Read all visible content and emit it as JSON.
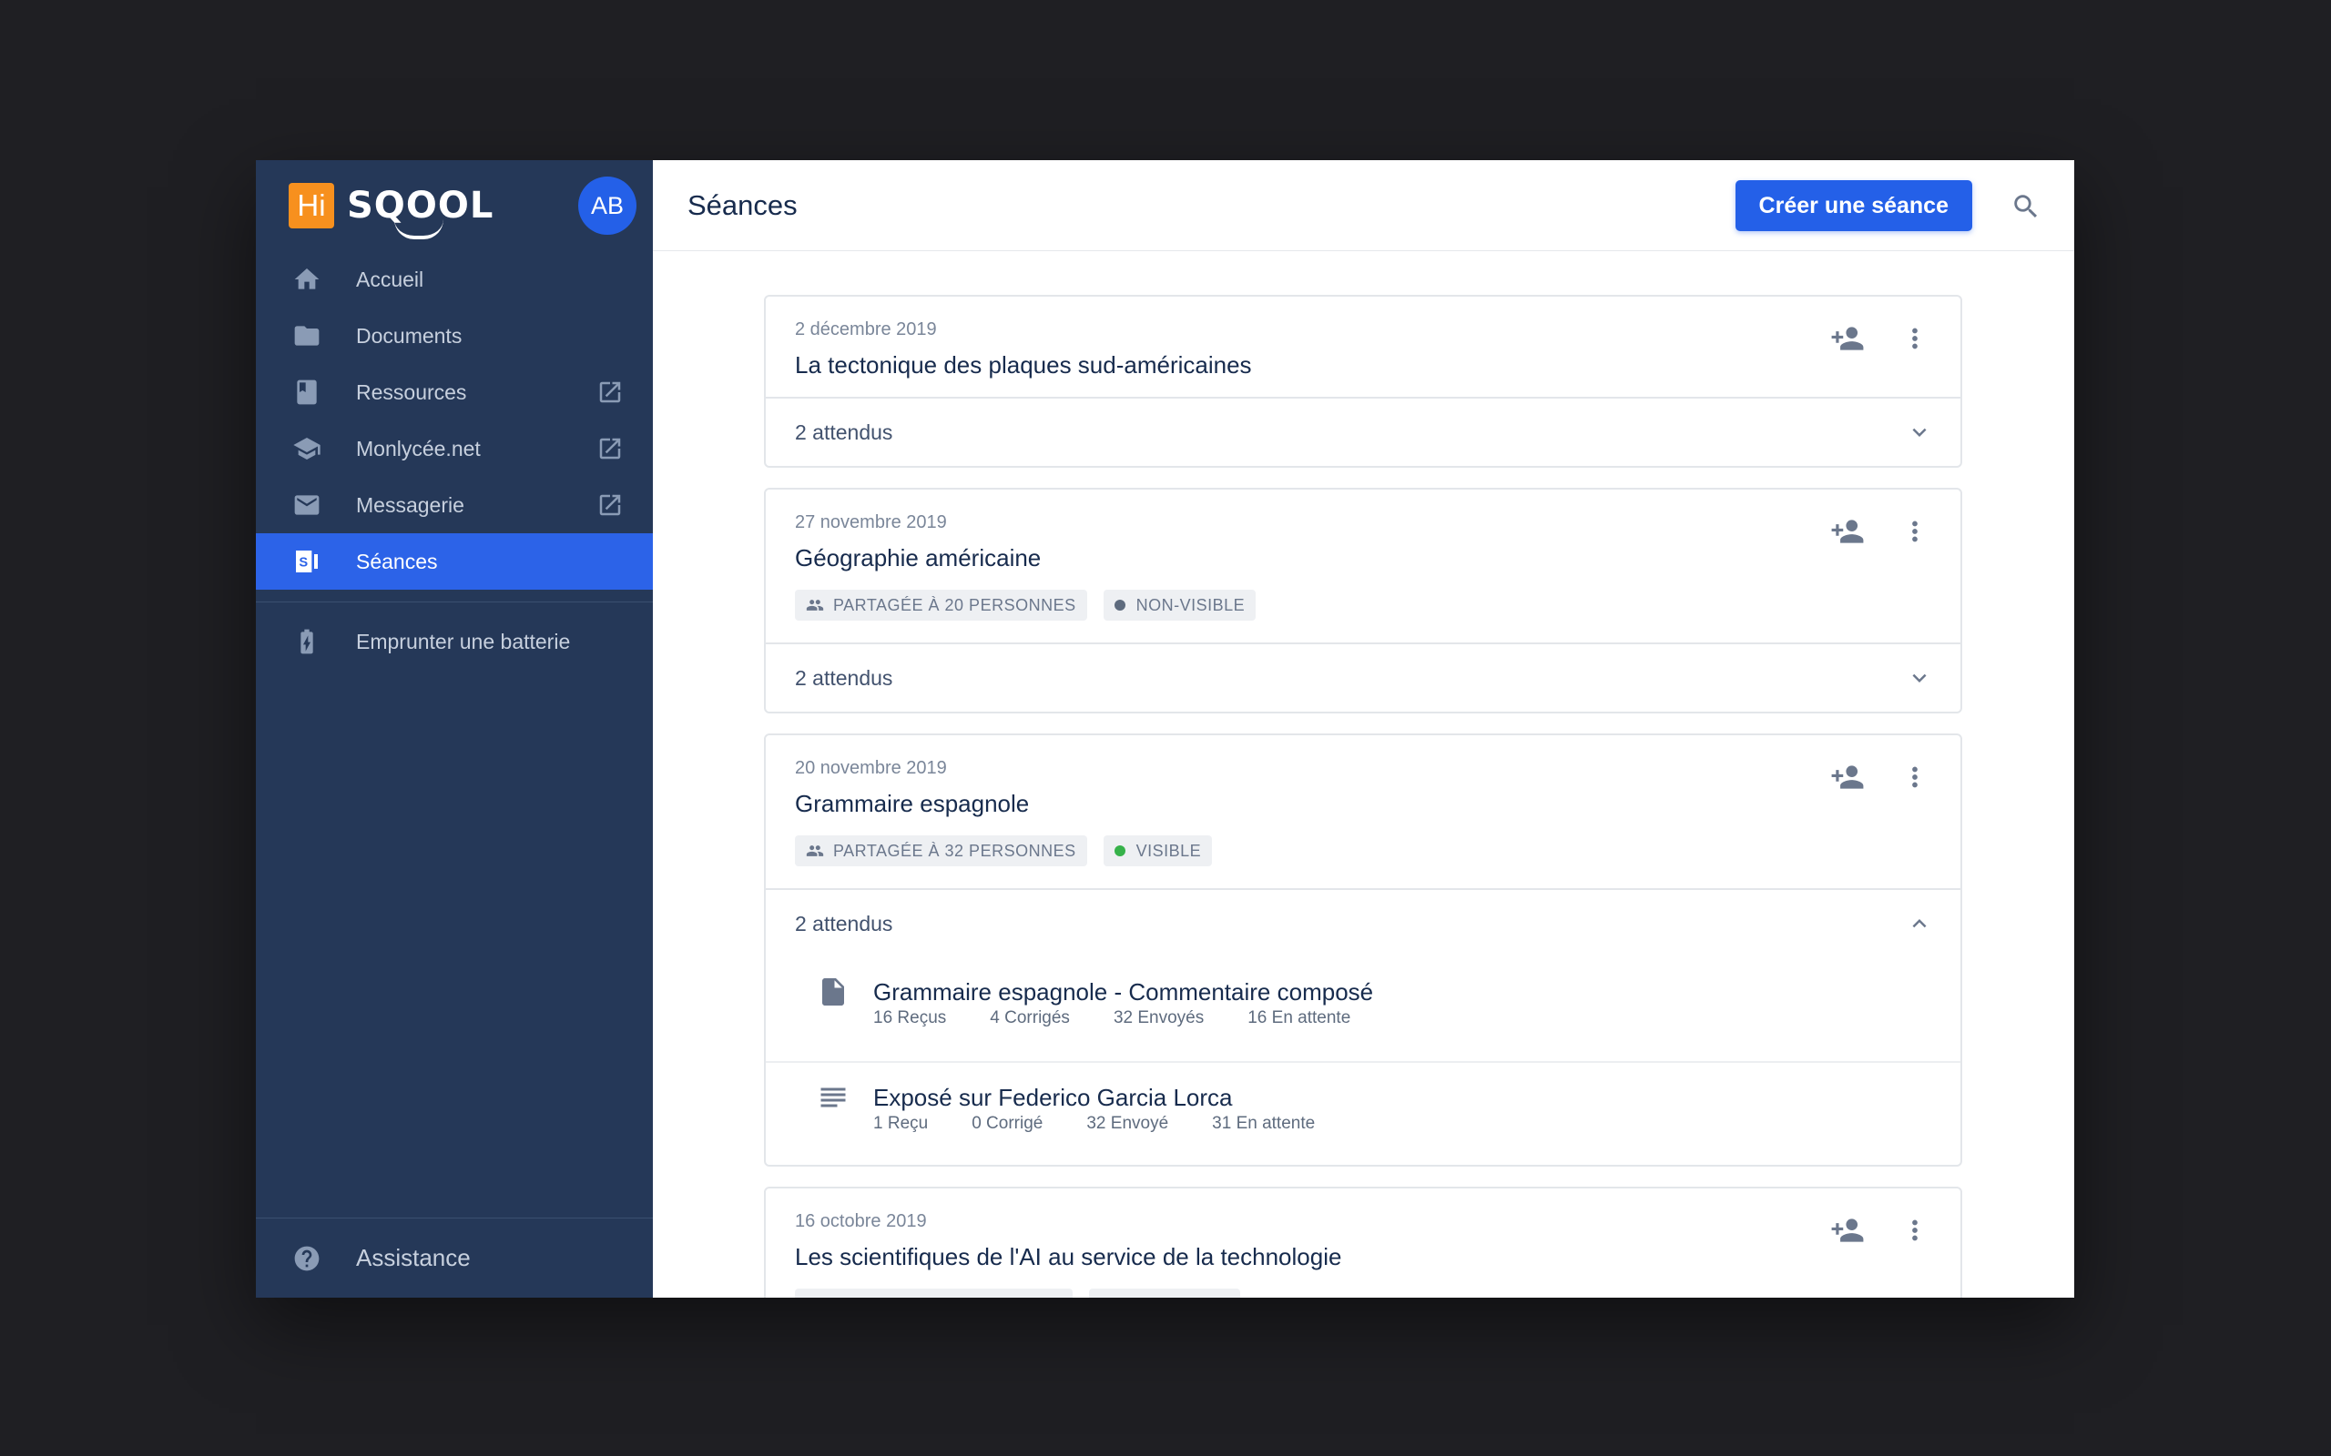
{
  "sidebar": {
    "logo_badge": "Hi",
    "logo_text": "SQOOL",
    "avatar": "AB",
    "items": [
      {
        "label": "Accueil",
        "icon": "home-icon",
        "external": false,
        "active": false
      },
      {
        "label": "Documents",
        "icon": "folder-icon",
        "external": false,
        "active": false
      },
      {
        "label": "Ressources",
        "icon": "book-icon",
        "external": true,
        "active": false
      },
      {
        "label": "Monlycée.net",
        "icon": "school-icon",
        "external": true,
        "active": false
      },
      {
        "label": "Messagerie",
        "icon": "mail-icon",
        "external": true,
        "active": false
      },
      {
        "label": "Séances",
        "icon": "sessions-icon",
        "external": false,
        "active": true
      }
    ],
    "secondary": {
      "label": "Emprunter une batterie",
      "icon": "battery-icon"
    },
    "assist_label": "Assistance"
  },
  "header": {
    "title": "Séances",
    "create_label": "Créer une séance"
  },
  "cards": [
    {
      "date": "2 décembre 2019",
      "title": "La tectonique des plaques sud-américaines",
      "attendus": "2 attendus",
      "expanded": false
    },
    {
      "date": "27 novembre 2019",
      "title": "Géographie américaine",
      "share_tag": "PARTAGÉE À 20 PERSONNES",
      "visibility_tag": "NON-VISIBLE",
      "attendus": "2 attendus",
      "expanded": false
    },
    {
      "date": "20 novembre 2019",
      "title": "Grammaire espagnole",
      "share_tag": "PARTAGÉE À 32 PERSONNES",
      "visibility_tag": "VISIBLE",
      "attendus": "2 attendus",
      "expanded": true,
      "items": [
        {
          "title": "Grammaire espagnole - Commentaire composé",
          "icon": "document-icon",
          "stats": [
            "16 Reçus",
            "4 Corrigés",
            "32 Envoyés",
            "16 En attente"
          ]
        },
        {
          "title": "Exposé sur Federico Garcia Lorca",
          "icon": "text-lines-icon",
          "stats": [
            "1 Reçu",
            "0 Corrigé",
            "32 Envoyé",
            "31 En attente"
          ]
        }
      ]
    },
    {
      "date": "16 octobre 2019",
      "title": "Les scientifiques de l'AI au service de la technologie"
    }
  ],
  "colors": {
    "accent": "#2460e8",
    "sidebar_bg": "#253858",
    "logo_orange": "#f7901e",
    "visible_green": "#36b24a"
  }
}
